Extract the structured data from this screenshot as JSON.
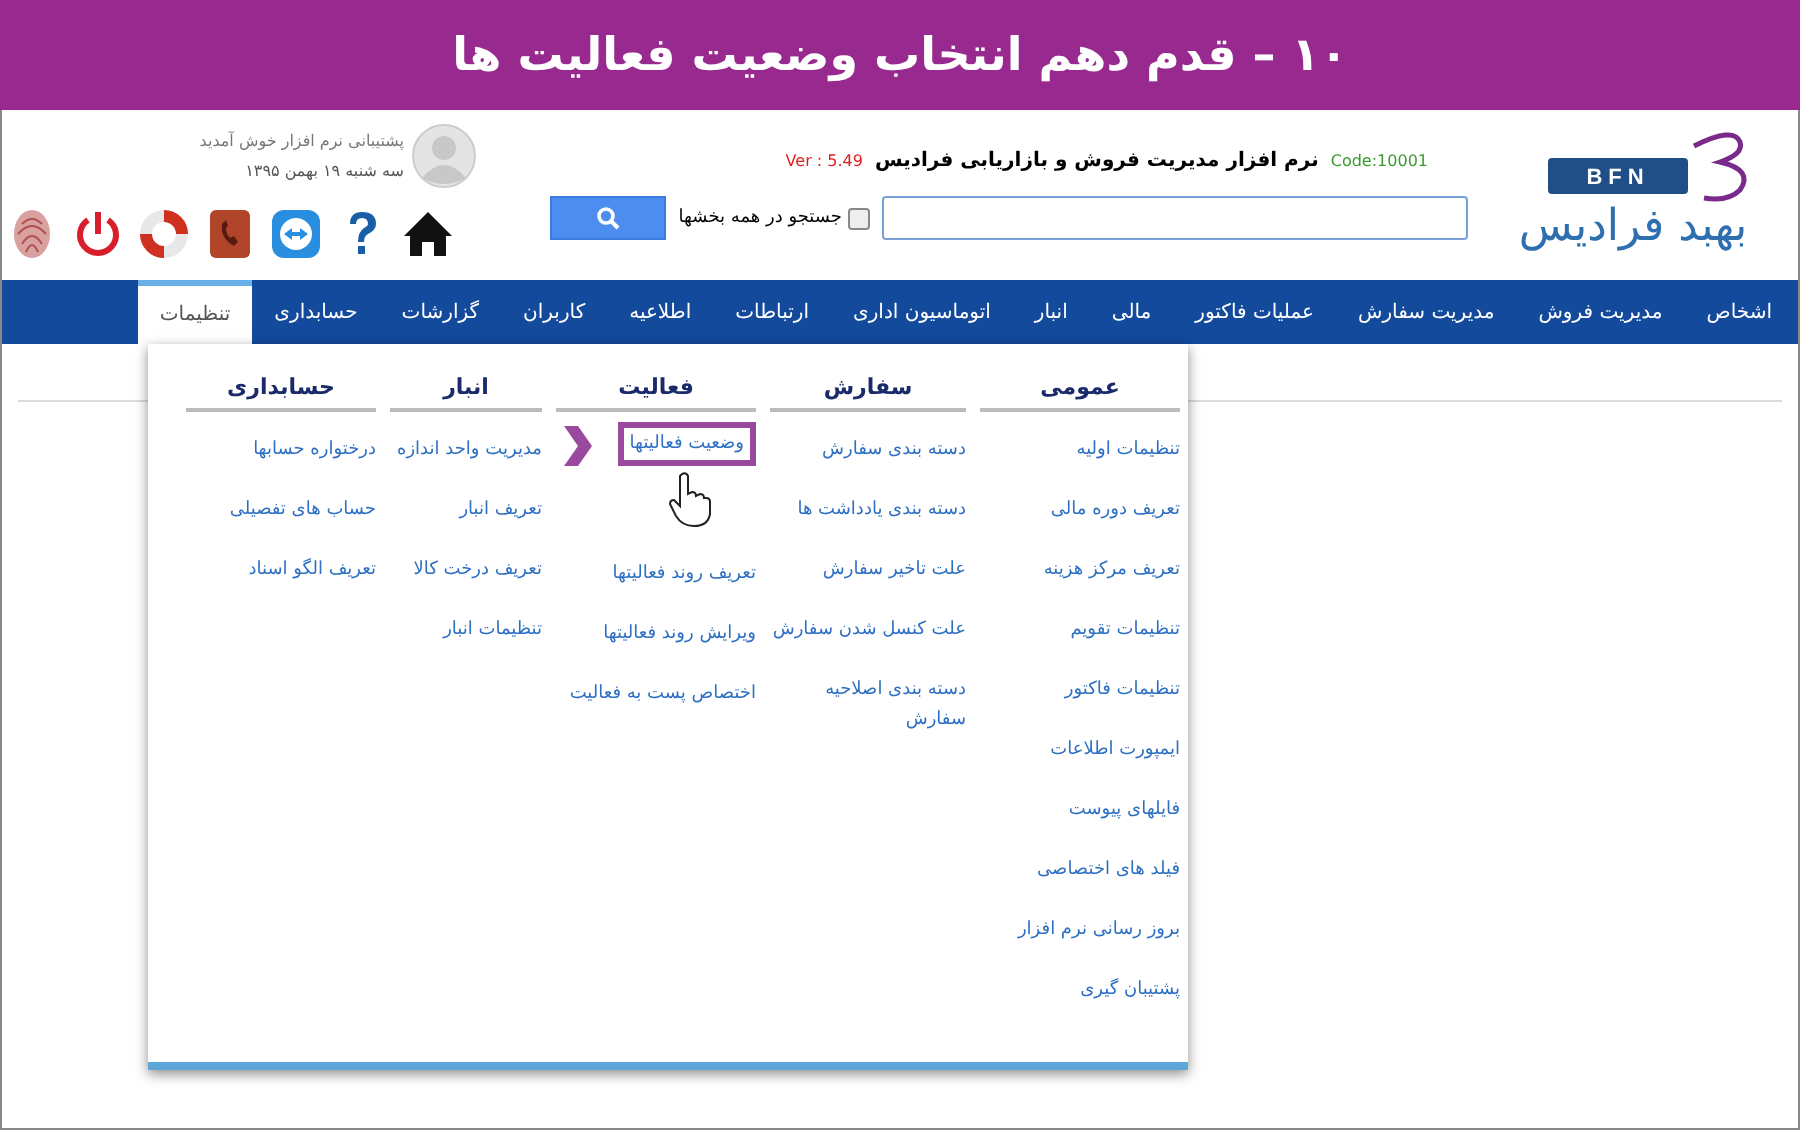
{
  "banner": {
    "title": "۱۰ – قدم دهم انتخاب وضعیت فعالیت ها"
  },
  "logo": {
    "badge": "BFN",
    "name": "بهبد فرادیس"
  },
  "app": {
    "title": "نرم افزار مدیریت فروش و بازاریابی فرادیس",
    "code": "Code:10001",
    "version": "Ver : 5.49"
  },
  "search": {
    "all_sections": {
      "label": "جستجو در همه بخشها",
      "checked": false
    }
  },
  "user": {
    "welcome": "پشتیبانی نرم افزار خوش آمدید",
    "date": "سه شنبه ۱۹ بهمن ۱۳۹۵"
  },
  "nav": [
    {
      "label": "اشخاص",
      "selected": false
    },
    {
      "label": "مدیریت فروش",
      "selected": false
    },
    {
      "label": "مدیریت سفارش",
      "selected": false
    },
    {
      "label": "عملیات فاکتور",
      "selected": false
    },
    {
      "label": "مالی",
      "selected": false
    },
    {
      "label": "انبار",
      "selected": false
    },
    {
      "label": "اتوماسیون اداری",
      "selected": false
    },
    {
      "label": "ارتباطات",
      "selected": false
    },
    {
      "label": "اطلاعیه",
      "selected": false
    },
    {
      "label": "کاربران",
      "selected": false
    },
    {
      "label": "گزارشات",
      "selected": false
    },
    {
      "label": "حسابداری",
      "selected": false
    },
    {
      "label": "تنظیمات",
      "selected": true
    }
  ],
  "menu": {
    "columns": [
      {
        "heading": "عمومی",
        "items": [
          {
            "label": "تنظیمات اولیه",
            "selected": false
          },
          {
            "label": "تعریف دوره مالی",
            "selected": false
          },
          {
            "label": "تعریف مرکز هزینه",
            "selected": false
          },
          {
            "label": "تنظیمات تقویم",
            "selected": false
          },
          {
            "label": "تنظیمات فاکتور",
            "selected": false
          },
          {
            "label": "ایمپورت اطلاعات",
            "selected": false
          },
          {
            "label": "فایلهای پیوست",
            "selected": false
          },
          {
            "label": "فیلد های اختصاصی",
            "selected": false
          },
          {
            "label": "بروز رسانی نرم افزار",
            "selected": false
          },
          {
            "label": "پشتیبان گیری",
            "selected": false
          }
        ]
      },
      {
        "heading": "سفارش",
        "items": [
          {
            "label": "دسته بندی سفارش",
            "selected": false
          },
          {
            "label": "دسته بندی یادداشت ها",
            "selected": false
          },
          {
            "label": "علت تاخیر سفارش",
            "selected": false
          },
          {
            "label": "علت کنسل شدن سفارش",
            "selected": false
          },
          {
            "label": "دسته بندی اصلاحیه سفارش",
            "selected": false
          }
        ]
      },
      {
        "heading": "فعالیت",
        "items": [
          {
            "label": "وضعیت فعالیتها",
            "selected": true
          },
          {
            "label": "تعریف روند فعالیتها",
            "selected": false
          },
          {
            "label": "ویرایش روند فعالیتها",
            "selected": false
          },
          {
            "label": "اختصاص پست به فعالیت",
            "selected": false
          }
        ]
      },
      {
        "heading": "انبار",
        "items": [
          {
            "label": "مدیریت واحد اندازه",
            "selected": false
          },
          {
            "label": "تعریف انبار",
            "selected": false
          },
          {
            "label": "تعریف درخت کالا",
            "selected": false
          },
          {
            "label": "تنظیمات انبار",
            "selected": false
          }
        ]
      },
      {
        "heading": "حسابداری",
        "items": [
          {
            "label": "درختواره حسابها",
            "selected": false
          },
          {
            "label": "حساب های تفصیلی",
            "selected": false
          },
          {
            "label": "تعریف الگو اسناد",
            "selected": false
          }
        ]
      }
    ]
  }
}
